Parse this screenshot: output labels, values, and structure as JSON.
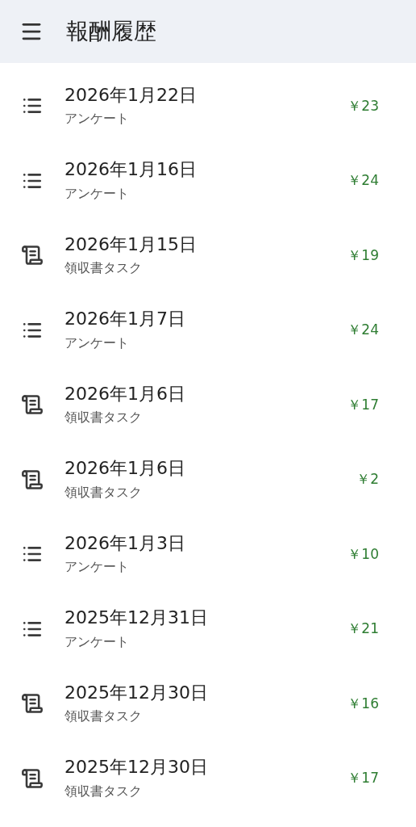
{
  "header": {
    "title": "報酬履歴"
  },
  "rewards": [
    {
      "kind": "survey",
      "date": "2026年1月22日",
      "label": "アンケート",
      "amount": "￥23"
    },
    {
      "kind": "survey",
      "date": "2026年1月16日",
      "label": "アンケート",
      "amount": "￥24"
    },
    {
      "kind": "receipt",
      "date": "2026年1月15日",
      "label": "領収書タスク",
      "amount": "￥19"
    },
    {
      "kind": "survey",
      "date": "2026年1月7日",
      "label": "アンケート",
      "amount": "￥24"
    },
    {
      "kind": "receipt",
      "date": "2026年1月6日",
      "label": "領収書タスク",
      "amount": "￥17"
    },
    {
      "kind": "receipt",
      "date": "2026年1月6日",
      "label": "領収書タスク",
      "amount": "￥2"
    },
    {
      "kind": "survey",
      "date": "2026年1月3日",
      "label": "アンケート",
      "amount": "￥10"
    },
    {
      "kind": "survey",
      "date": "2025年12月31日",
      "label": "アンケート",
      "amount": "￥21"
    },
    {
      "kind": "receipt",
      "date": "2025年12月30日",
      "label": "領収書タスク",
      "amount": "￥16"
    },
    {
      "kind": "receipt",
      "date": "2025年12月30日",
      "label": "領収書タスク",
      "amount": "￥17"
    }
  ]
}
